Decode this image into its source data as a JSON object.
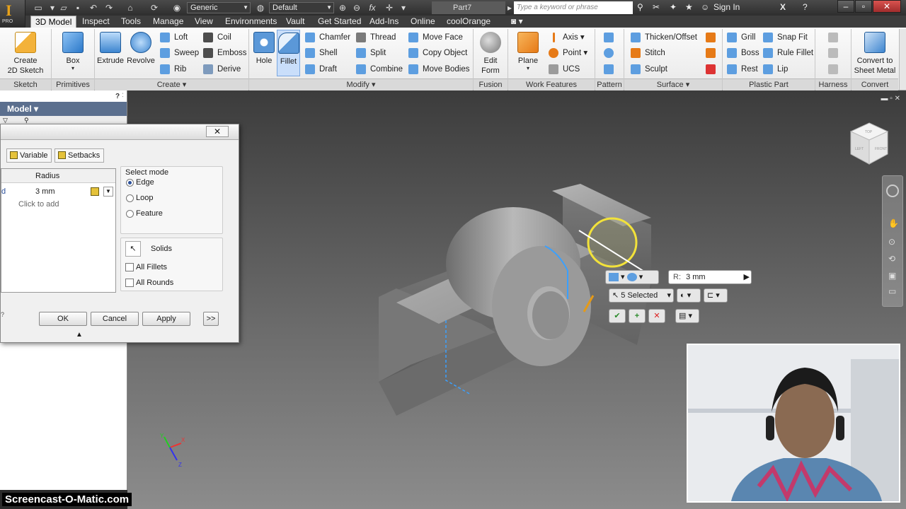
{
  "titlebar": {
    "style_combo": "Generic",
    "appearance_combo": "Default",
    "doc_title": "Part7",
    "search_placeholder": "Type a keyword or phrase",
    "sign_in": "Sign In",
    "pro_label": "PRO"
  },
  "tabs": [
    "3D Model",
    "Inspect",
    "Tools",
    "Manage",
    "View",
    "Environments",
    "Vault",
    "Get Started",
    "Add-Ins",
    "Online",
    "coolOrange"
  ],
  "ribbon": {
    "sketch": {
      "create_sketch": "Create\n2D Sketch",
      "label": "Sketch"
    },
    "primitives": {
      "box": "Box",
      "label": "Primitives"
    },
    "create": {
      "extrude": "Extrude",
      "revolve": "Revolve",
      "loft": "Loft",
      "sweep": "Sweep",
      "rib": "Rib",
      "coil": "Coil",
      "emboss": "Emboss",
      "derive": "Derive",
      "label": "Create"
    },
    "modify": {
      "hole": "Hole",
      "fillet": "Fillet",
      "chamfer": "Chamfer",
      "shell": "Shell",
      "draft": "Draft",
      "thread": "Thread",
      "split": "Split",
      "combine": "Combine",
      "move_face": "Move Face",
      "copy_object": "Copy Object",
      "move_bodies": "Move Bodies",
      "label": "Modify"
    },
    "fusion": {
      "edit_form": "Edit\nForm",
      "label": "Fusion"
    },
    "work_features": {
      "plane": "Plane",
      "axis": "Axis",
      "point": "Point",
      "ucs": "UCS",
      "label": "Work Features"
    },
    "pattern": {
      "label": "Pattern"
    },
    "surface": {
      "thicken": "Thicken/Offset",
      "stitch": "Stitch",
      "sculpt": "Sculpt",
      "label": "Surface"
    },
    "plastic": {
      "grill": "Grill",
      "boss": "Boss",
      "rest": "Rest",
      "snap_fit": "Snap Fit",
      "rule_fillet": "Rule Fillet",
      "lip": "Lip",
      "label": "Plastic Part"
    },
    "harness": {
      "label": "Harness"
    },
    "convert": {
      "convert_sheet_metal": "Convert to\nSheet Metal",
      "label": "Convert"
    }
  },
  "browser": {
    "title": "Model ▾"
  },
  "dialog": {
    "tab_variable": "Variable",
    "tab_setbacks": "Setbacks",
    "col_radius": "Radius",
    "row_value": "3 mm",
    "click_to_add": "Click to add",
    "select_mode_label": "Select mode",
    "mode_edge": "Edge",
    "mode_loop": "Loop",
    "mode_feature": "Feature",
    "selected_mode": "Edge",
    "solids": "Solids",
    "all_fillets": "All Fillets",
    "all_rounds": "All Rounds",
    "ok": "OK",
    "cancel": "Cancel",
    "apply": "Apply",
    "more": ">>"
  },
  "minitoolbar": {
    "radius_label": "R:",
    "radius_value": "3 mm",
    "selected": "5 Selected"
  },
  "viewcube": {
    "top": "TOP",
    "front": "FRONT",
    "left": "LEFT"
  },
  "axes": {
    "x": "X",
    "y": "Y",
    "z": "Z"
  },
  "watermark": "Screencast-O-Matic.com",
  "colors": {
    "ribbon_bg": "#f0f0f0",
    "browser_header": "#5b6f8e",
    "accent_highlight": "#c9defa",
    "part_gray": "#8d8d8d"
  }
}
